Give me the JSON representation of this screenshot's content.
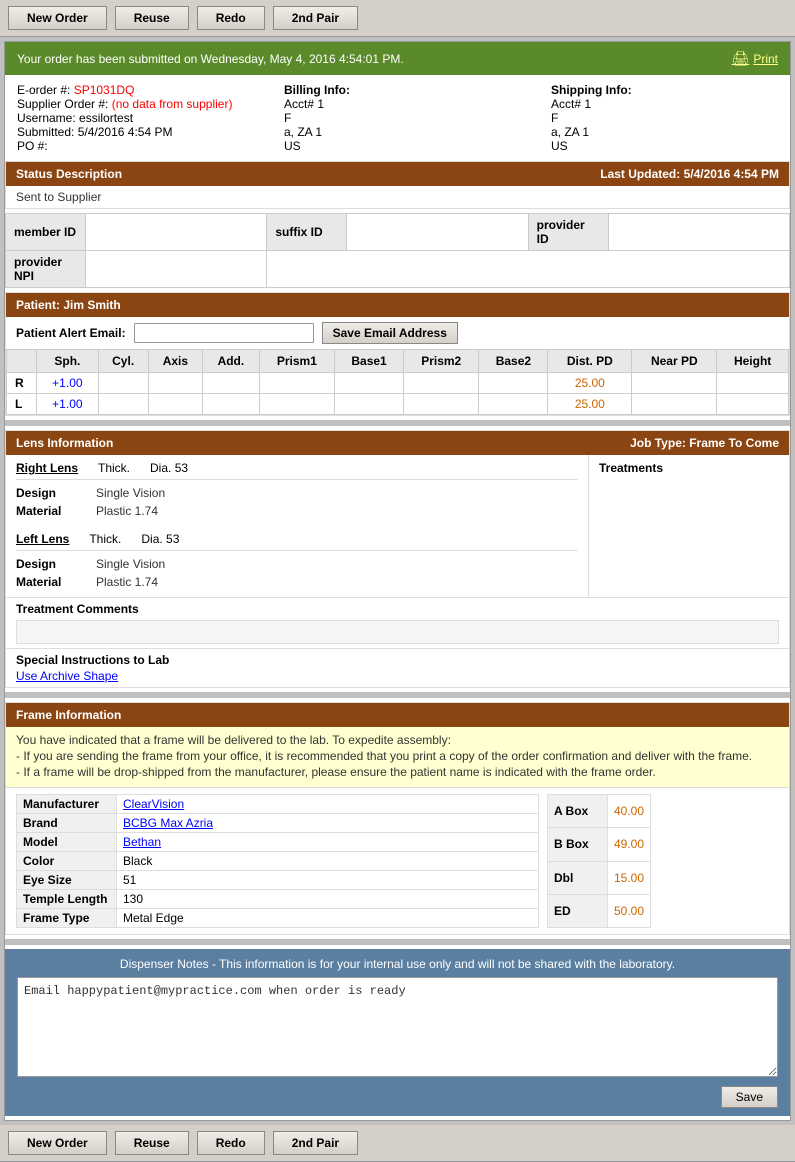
{
  "toolbar": {
    "new_order": "New Order",
    "reuse": "Reuse",
    "redo": "Redo",
    "second_pair": "2nd Pair"
  },
  "success_bar": {
    "message": "Your order has been submitted on Wednesday, May 4, 2016 4:54:01 PM.",
    "print_label": "Print"
  },
  "order_info": {
    "eorder_label": "E-order #:",
    "eorder_value": "SP1031DQ",
    "supplier_label": "Supplier Order #:",
    "supplier_value": "(no data from supplier)",
    "username_label": "Username:",
    "username_value": "essilortest",
    "submitted_label": "Submitted:",
    "submitted_value": "5/4/2016 4:54 PM",
    "po_label": "PO #:",
    "po_value": "",
    "billing_label": "Billing Info:",
    "billing_acct": "Acct# 1",
    "billing_f": "F",
    "billing_za": "a, ZA 1",
    "billing_us": "US",
    "shipping_label": "Shipping Info:",
    "shipping_acct": "Acct# 1",
    "shipping_f": "F",
    "shipping_za": "a, ZA 1",
    "shipping_us": "US"
  },
  "status": {
    "header": "Status Description",
    "last_updated_label": "Last Updated:",
    "last_updated_value": "5/4/2016 4:54 PM",
    "sent_to": "Sent to Supplier"
  },
  "ids": {
    "member_id_label": "member ID",
    "member_id_value": "",
    "suffix_id_label": "suffix ID",
    "suffix_id_value": "",
    "provider_id_label": "provider ID",
    "provider_id_value": "",
    "provider_npi_label": "provider NPI",
    "provider_npi_value": ""
  },
  "patient": {
    "header": "Patient: Jim Smith",
    "alert_email_label": "Patient Alert Email:",
    "alert_email_value": "",
    "alert_email_placeholder": "",
    "save_email_btn": "Save Email Address"
  },
  "rx": {
    "headers": [
      "Sph.",
      "Cyl.",
      "Axis",
      "Add.",
      "Prism1",
      "Base1",
      "Prism2",
      "Base2",
      "Dist. PD",
      "Near PD",
      "Height"
    ],
    "rows": [
      {
        "eye": "R",
        "sph": "+1.00",
        "cyl": "",
        "axis": "",
        "add": "",
        "prism1": "",
        "base1": "",
        "prism2": "",
        "base2": "",
        "dist_pd": "25.00",
        "near_pd": "",
        "height": ""
      },
      {
        "eye": "L",
        "sph": "+1.00",
        "cyl": "",
        "axis": "",
        "add": "",
        "prism1": "",
        "base1": "",
        "prism2": "",
        "base2": "",
        "dist_pd": "25.00",
        "near_pd": "",
        "height": ""
      }
    ]
  },
  "lens": {
    "header": "Lens Information",
    "job_type": "Job Type: Frame To Come",
    "right_lens": "Right Lens",
    "right_thick": "Thick.",
    "right_dia": "Dia. 53",
    "right_design_label": "Design",
    "right_design_val": "Single Vision",
    "right_material_label": "Material",
    "right_material_val": "Plastic 1.74",
    "left_lens": "Left Lens",
    "left_thick": "Thick.",
    "left_dia": "Dia. 53",
    "left_design_label": "Design",
    "left_design_val": "Single Vision",
    "left_material_label": "Material",
    "left_material_val": "Plastic 1.74",
    "treatments_label": "Treatments"
  },
  "treatment_comments": {
    "label": "Treatment Comments",
    "value": ""
  },
  "special_instructions": {
    "label": "Special Instructions to Lab",
    "archive_text": "Use Archive Shape"
  },
  "frame": {
    "header": "Frame Information",
    "notice1": "You have indicated that a frame will be delivered to the lab. To expedite assembly:",
    "notice2": "- If you are sending the frame from your office, it is recommended that you print a copy of the order confirmation and deliver with the frame.",
    "notice3": "- If a frame will be drop-shipped from the manufacturer, please ensure the patient name is indicated with the frame order.",
    "manufacturer_label": "Manufacturer",
    "manufacturer_val": "ClearVision",
    "brand_label": "Brand",
    "brand_val": "BCBG Max Azria",
    "model_label": "Model",
    "model_val": "Bethan",
    "color_label": "Color",
    "color_val": "Black",
    "eye_size_label": "Eye Size",
    "eye_size_val": "51",
    "temple_length_label": "Temple Length",
    "temple_length_val": "130",
    "frame_type_label": "Frame Type",
    "frame_type_val": "Metal Edge",
    "a_box_label": "A Box",
    "a_box_val": "40.00",
    "b_box_label": "B Box",
    "b_box_val": "49.00",
    "dbl_label": "Dbl",
    "dbl_val": "15.00",
    "ed_label": "ED",
    "ed_val": "50.00"
  },
  "dispenser": {
    "title": "Dispenser Notes - This information is for your internal use only and will not be shared with the laboratory.",
    "notes": "Email happypatient@mypractice.com when order is ready",
    "save_btn": "Save"
  }
}
